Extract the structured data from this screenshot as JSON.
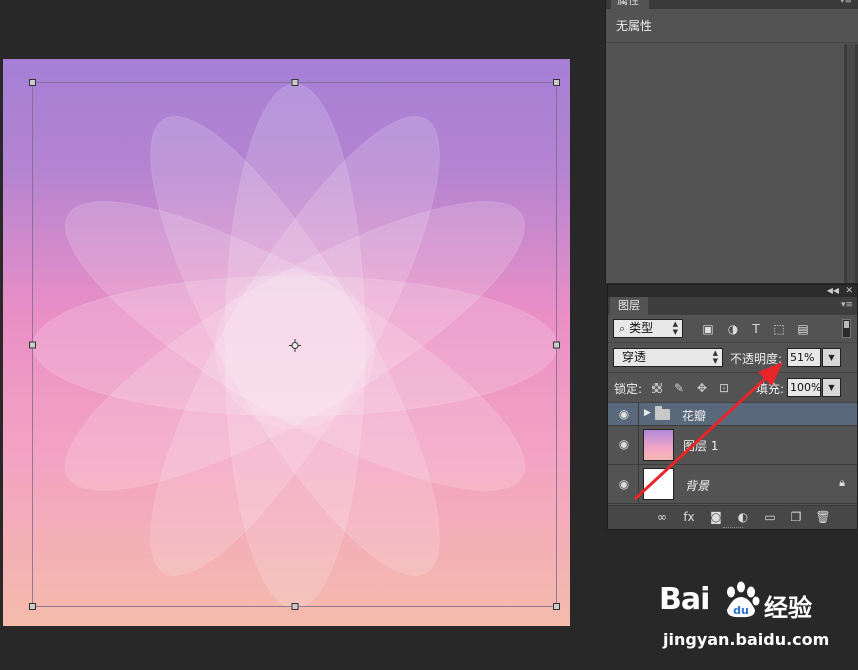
{
  "colors": {
    "canvas_top": "#a880d5",
    "canvas_mid": "#ee92c4",
    "canvas_bottom": "#f4b8ae",
    "panel_bg": "#535353",
    "selected_layer": "#5a687c",
    "arrow_red": "#e8262a"
  },
  "properties_panel": {
    "tab_label": "属性",
    "empty_text": "无属性"
  },
  "layers_panel": {
    "tab_label": "图层",
    "filter": {
      "kind_label": "类型",
      "icons": [
        "image-filter-icon",
        "adjustment-filter-icon",
        "type-filter-icon",
        "shape-filter-icon",
        "smart-object-filter-icon"
      ]
    },
    "blend_mode": "穿透",
    "opacity_label": "不透明度:",
    "opacity_value": "51%",
    "lock_label": "锁定:",
    "fill_label": "填充:",
    "fill_value": "100%",
    "layers": [
      {
        "name": "花瓣",
        "type": "group",
        "selected": true
      },
      {
        "name": "图层 1",
        "type": "gradient"
      },
      {
        "name": "背景",
        "type": "background",
        "locked": true
      }
    ],
    "bottom_icons": [
      "link-icon",
      "fx-icon",
      "mask-icon",
      "adjustment-icon",
      "folder-icon",
      "new-layer-icon",
      "trash-icon"
    ]
  },
  "watermark": {
    "brand": "Bai",
    "paw_text": "du",
    "product": "经验",
    "url": "jingyan.baidu.com"
  }
}
